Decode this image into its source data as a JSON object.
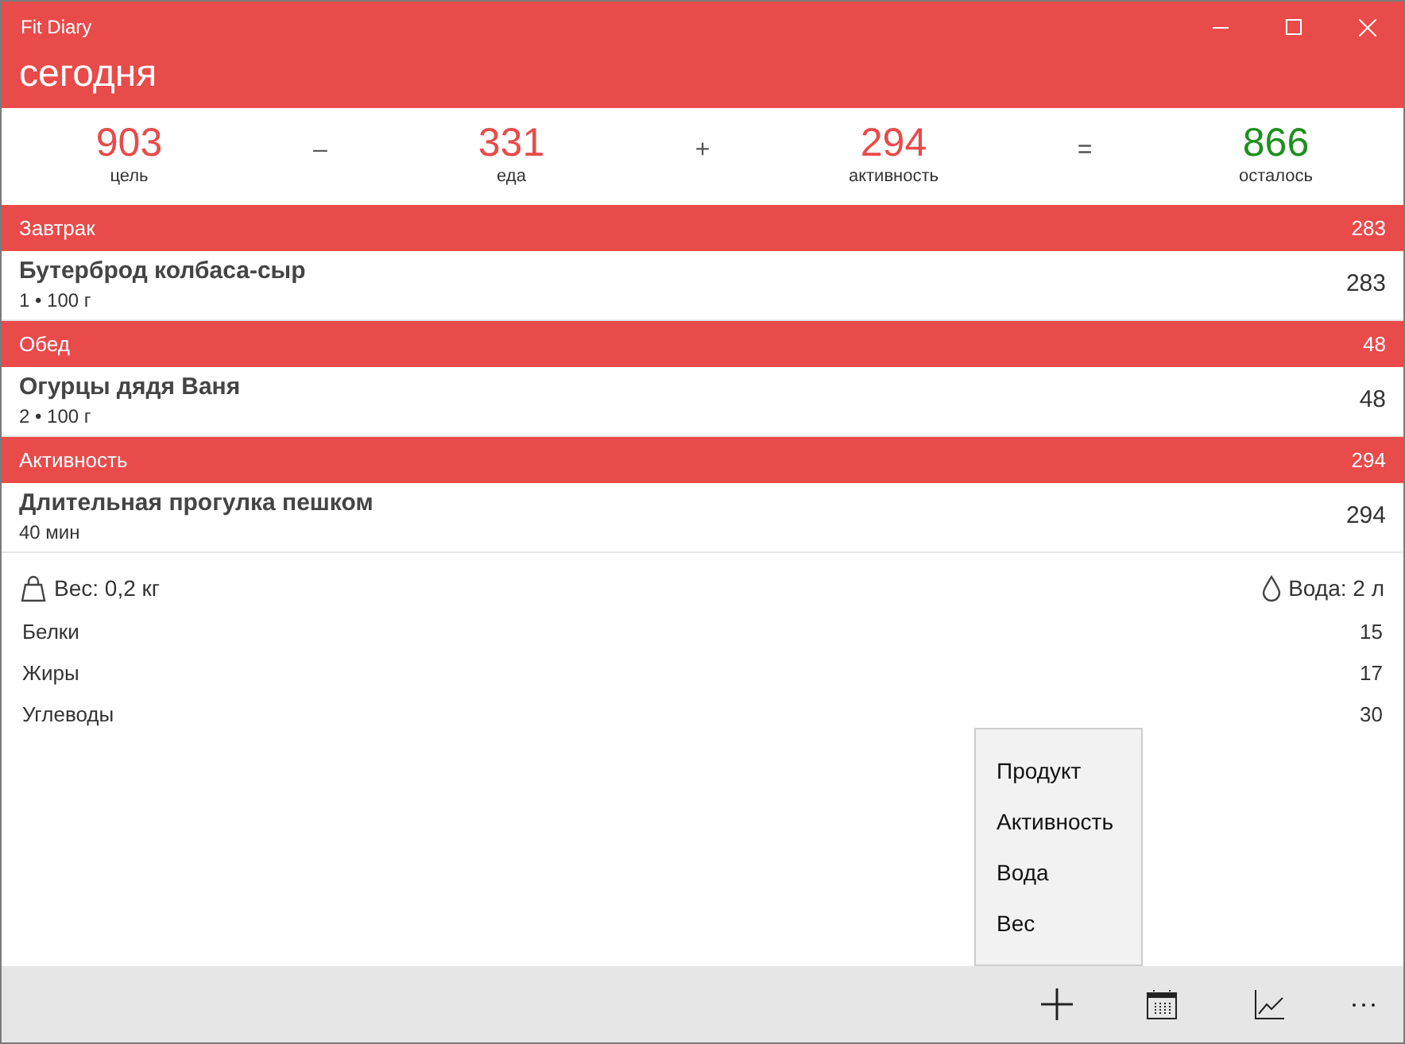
{
  "window": {
    "title": "Fit Diary"
  },
  "page_title": "сегодня",
  "summary": [
    {
      "kind": "value",
      "value": "903",
      "label": "цель",
      "color": "#e94a4a"
    },
    {
      "kind": "operator",
      "value": "–"
    },
    {
      "kind": "value",
      "value": "331",
      "label": "еда",
      "color": "#e94a4a"
    },
    {
      "kind": "operator",
      "value": "+"
    },
    {
      "kind": "value",
      "value": "294",
      "label": "активность",
      "color": "#e94a4a"
    },
    {
      "kind": "operator",
      "value": "="
    },
    {
      "kind": "value",
      "value": "866",
      "label": "осталось",
      "color": "#1f8f1f"
    }
  ],
  "sections": [
    {
      "title": "Завтрак",
      "total": "283",
      "items": [
        {
          "name": "Бутерброд колбаса-сыр",
          "detail": "1 • 100 г",
          "value": "283"
        }
      ]
    },
    {
      "title": "Обед",
      "total": "48",
      "items": [
        {
          "name": "Огурцы дядя Ваня",
          "detail": "2 • 100 г",
          "value": "48"
        }
      ]
    },
    {
      "title": "Активность",
      "total": "294",
      "items": [
        {
          "name": "Длительная прогулка пешком",
          "detail": "40 мин",
          "value": "294"
        }
      ]
    }
  ],
  "weight": "Вес: 0,2 кг",
  "water": "Вода: 2 л",
  "nutrients": [
    {
      "name": "Белки",
      "value": "15"
    },
    {
      "name": "Жиры",
      "value": "17"
    },
    {
      "name": "Углеводы",
      "value": "30"
    }
  ],
  "menu": [
    "Продукт",
    "Активность",
    "Вода",
    "Вес"
  ]
}
